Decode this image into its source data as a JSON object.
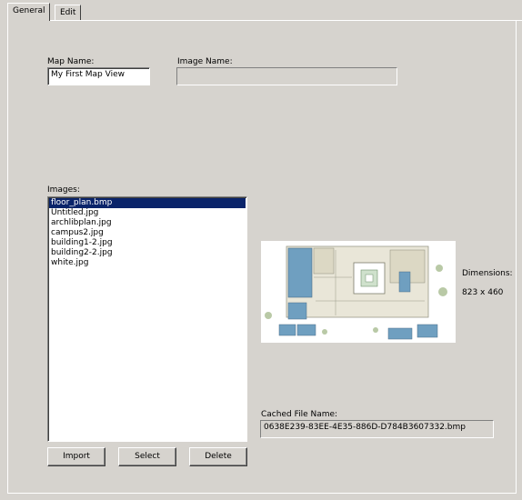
{
  "tabs": [
    {
      "label": "General"
    },
    {
      "label": "Edit"
    }
  ],
  "form": {
    "map_name_label": "Map Name:",
    "map_name_value": "My First Map View",
    "image_name_label": "Image Name:",
    "image_name_value": "",
    "images_label": "Images:",
    "images": [
      "floor_plan.bmp",
      "Untitled.jpg",
      "archlibplan.jpg",
      "campus2.jpg",
      "building1-2.jpg",
      "building2-2.jpg",
      "white.jpg"
    ],
    "selected_image": "floor_plan.bmp",
    "dimensions_label": "Dimensions:",
    "dimensions_value": "823 x 460",
    "cached_label": "Cached File Name:",
    "cached_value": "0638E239-83EE-4E35-886D-D784B3607332.bmp"
  },
  "buttons": {
    "import": "Import",
    "select": "Select",
    "delete": "Delete"
  }
}
